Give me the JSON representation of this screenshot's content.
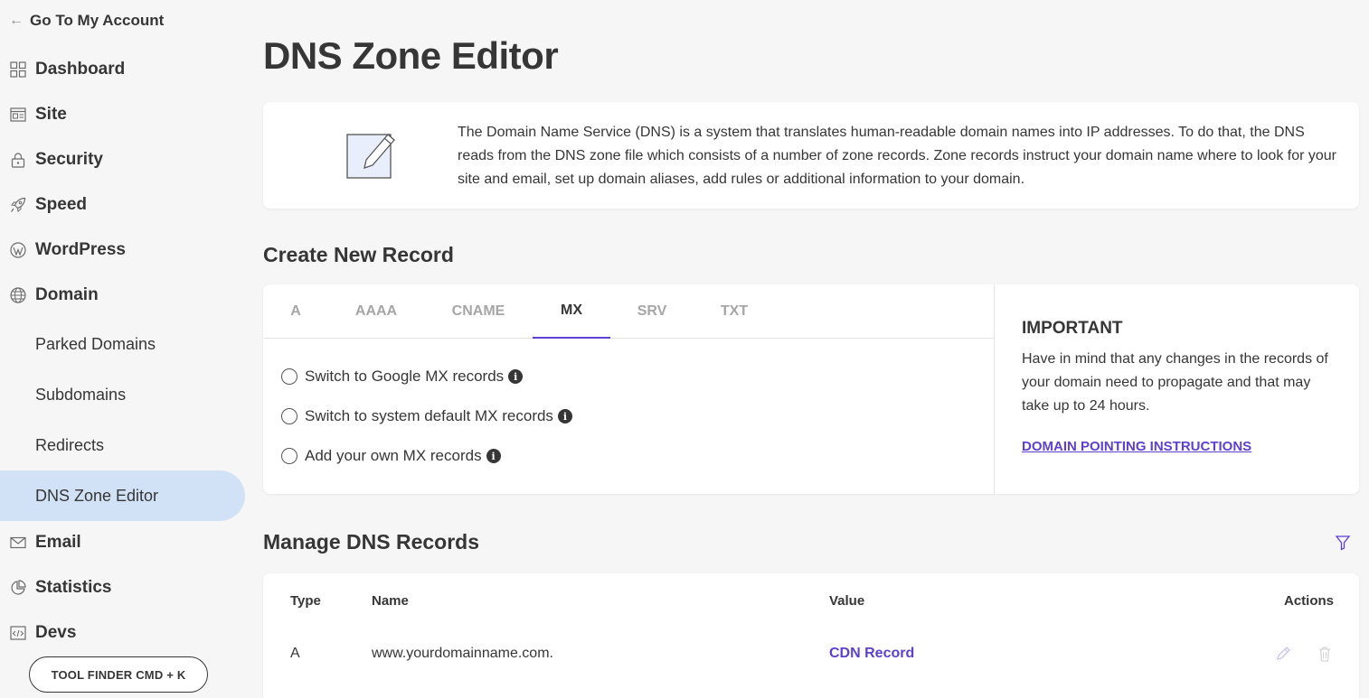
{
  "sidebar": {
    "back_label": "Go To My Account",
    "items": [
      {
        "label": "Dashboard",
        "icon": "grid-icon"
      },
      {
        "label": "Site",
        "icon": "site-icon"
      },
      {
        "label": "Security",
        "icon": "lock-icon"
      },
      {
        "label": "Speed",
        "icon": "rocket-icon"
      },
      {
        "label": "WordPress",
        "icon": "wordpress-icon"
      },
      {
        "label": "Domain",
        "icon": "globe-icon"
      }
    ],
    "domain_subitems": [
      {
        "label": "Parked Domains"
      },
      {
        "label": "Subdomains"
      },
      {
        "label": "Redirects"
      },
      {
        "label": "DNS Zone Editor",
        "active": true
      }
    ],
    "items_after": [
      {
        "label": "Email",
        "icon": "envelope-icon"
      },
      {
        "label": "Statistics",
        "icon": "pie-chart-icon"
      },
      {
        "label": "Devs",
        "icon": "code-icon"
      }
    ],
    "tool_finder_label": "TOOL FINDER CMD + K"
  },
  "page": {
    "title": "DNS Zone Editor",
    "intro": "The Domain Name Service (DNS) is a system that translates human-readable domain names into IP addresses. To do that, the DNS reads from the DNS zone file which consists of a number of zone records. Zone records instruct your domain name where to look for your site and email, set up domain aliases, add rules or additional information to your domain."
  },
  "create_record": {
    "title": "Create New Record",
    "tabs": [
      "A",
      "AAAA",
      "CNAME",
      "MX",
      "SRV",
      "TXT"
    ],
    "active_tab": "MX",
    "options": [
      "Switch to Google MX records",
      "Switch to system default MX records",
      "Add your own MX records"
    ],
    "important_title": "IMPORTANT",
    "important_text": "Have in mind that any changes in the records of your domain need to propagate and that may take up to 24 hours.",
    "important_link": "DOMAIN POINTING INSTRUCTIONS"
  },
  "manage": {
    "title": "Manage DNS Records",
    "columns": [
      "Type",
      "Name",
      "Value",
      "Actions"
    ],
    "rows": [
      {
        "type": "A",
        "name": "www.yourdomainname.com.",
        "value": "CDN Record"
      }
    ]
  },
  "colors": {
    "accent": "#5d3fd3",
    "active_nav_bg": "#d1e2f7",
    "text": "#363636"
  }
}
